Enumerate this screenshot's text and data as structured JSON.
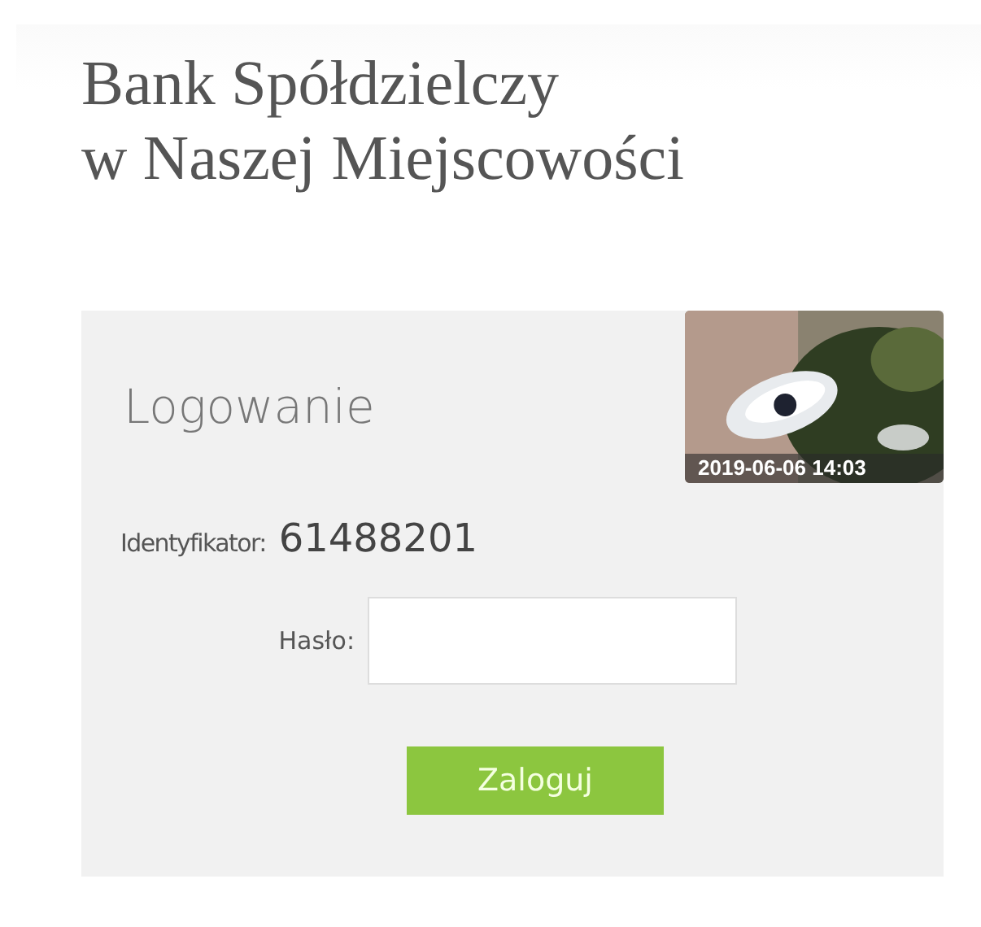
{
  "bank_name": [
    "Bank Spółdzielczy",
    "w Naszej Miejscowości"
  ],
  "login": {
    "title": "Logowanie",
    "image": {
      "timestamp": "2019-06-06 14:03"
    },
    "identifier_label": "Identyfikator:",
    "identifier_value": "61488201",
    "password_label": "Hasło:",
    "button": "Zaloguj"
  }
}
